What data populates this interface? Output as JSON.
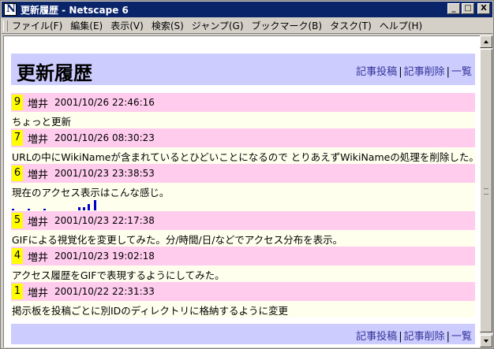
{
  "window": {
    "title": "更新履歴 - Netscape 6",
    "buttons": [
      "_",
      "□",
      "X"
    ]
  },
  "menubar": {
    "items": [
      "ファイル(F)",
      "編集(E)",
      "表示(V)",
      "検索(S)",
      "ジャンプ(G)",
      "ブックマーク(B)",
      "タスク(T)",
      "ヘルプ(H)"
    ]
  },
  "header": {
    "title": "更新履歴",
    "links": [
      "記事投稿",
      "記事削除",
      "一覧"
    ]
  },
  "entries": [
    {
      "num": "9",
      "author": "増井",
      "date": "2001/10/26 22:46:16",
      "body": "ちょっと更新"
    },
    {
      "num": "7",
      "author": "増井",
      "date": "2001/10/26 08:30:23",
      "body": "URLの中にWikiNameが含まれているとひどいことになるので とりあえずWikiNameの処理を削除した。"
    },
    {
      "num": "6",
      "author": "増井",
      "date": "2001/10/23 23:38:53",
      "body": "現在のアクセス表示はこんな感じ。",
      "graph": [
        0.1,
        0.05,
        0.1,
        0.25,
        0.3,
        0.55,
        0.9
      ]
    },
    {
      "num": "5",
      "author": "増井",
      "date": "2001/10/23 22:17:38",
      "body": "GIFによる視覚化を変更してみた。分/時間/日/などでアクセス分布を表示。"
    },
    {
      "num": "4",
      "author": "増井",
      "date": "2001/10/23 19:02:18",
      "body": "アクセス履歴をGIFで表現するようにしてみた。"
    },
    {
      "num": "1",
      "author": "増井",
      "date": "2001/10/22 22:31:33",
      "body": "掲示板を投稿ごとに別IDのディレクトリに格納するように変更"
    }
  ],
  "footer": {
    "links": [
      "記事投稿",
      "記事削除",
      "一覧"
    ]
  }
}
